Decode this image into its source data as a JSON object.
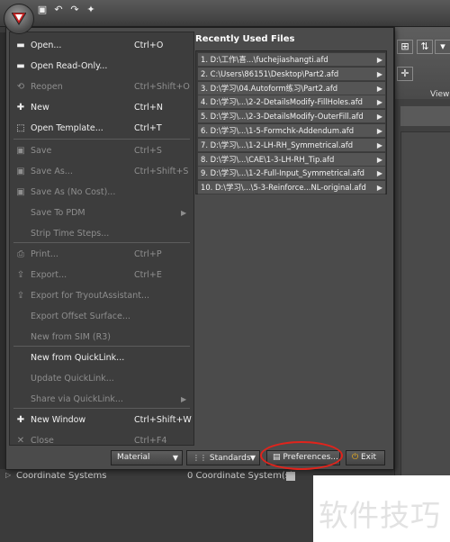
{
  "menu": {
    "items": [
      {
        "icon": "open-folder-icon",
        "label": "Open...",
        "shortcut": "Ctrl+O",
        "enabled": true
      },
      {
        "icon": "open-folder-icon",
        "label": "Open Read-Only...",
        "shortcut": "",
        "enabled": true
      },
      {
        "icon": "reopen-icon",
        "label": "Reopen",
        "shortcut": "Ctrl+Shift+O",
        "enabled": false
      },
      {
        "icon": "new-icon",
        "label": "New",
        "shortcut": "Ctrl+N",
        "enabled": true
      },
      {
        "icon": "template-icon",
        "label": "Open Template...",
        "shortcut": "Ctrl+T",
        "enabled": true
      },
      {
        "icon": "save-icon",
        "label": "Save",
        "shortcut": "Ctrl+S",
        "enabled": false
      },
      {
        "icon": "save-as-icon",
        "label": "Save As...",
        "shortcut": "Ctrl+Shift+S",
        "enabled": false
      },
      {
        "icon": "save-as-icon",
        "label": "Save As (No Cost)...",
        "shortcut": "",
        "enabled": false
      },
      {
        "icon": "",
        "label": "Save To PDM",
        "shortcut": "",
        "enabled": false,
        "submenu": true
      },
      {
        "icon": "",
        "label": "Strip Time Steps...",
        "shortcut": "",
        "enabled": false
      },
      {
        "icon": "print-icon",
        "label": "Print...",
        "shortcut": "Ctrl+P",
        "enabled": false
      },
      {
        "icon": "export-icon",
        "label": "Export...",
        "shortcut": "Ctrl+E",
        "enabled": false
      },
      {
        "icon": "export-icon",
        "label": "Export for TryoutAssistant...",
        "shortcut": "",
        "enabled": false
      },
      {
        "icon": "",
        "label": "Export Offset Surface...",
        "shortcut": "",
        "enabled": false
      },
      {
        "icon": "",
        "label": "New from SIM (R3)",
        "shortcut": "",
        "enabled": false
      },
      {
        "icon": "",
        "label": "New from QuickLink...",
        "shortcut": "",
        "enabled": true
      },
      {
        "icon": "",
        "label": "Update QuickLink...",
        "shortcut": "",
        "enabled": false
      },
      {
        "icon": "",
        "label": "Share via QuickLink...",
        "shortcut": "",
        "enabled": false,
        "submenu": true
      },
      {
        "icon": "new-window-icon",
        "label": "New Window",
        "shortcut": "Ctrl+Shift+W",
        "enabled": true
      },
      {
        "icon": "close-icon",
        "label": "Close",
        "shortcut": "Ctrl+F4",
        "enabled": false
      }
    ],
    "recent_title": "Recently Used Files",
    "recent_files": [
      "1. D:\\工作\\喜...\\fuchejiashangti.afd",
      "2. C:\\Users\\86151\\Desktop\\Part2.afd",
      "3. D:\\学习\\04.Autoform练习\\Part2.afd",
      "4. D:\\学习\\...\\2-2-DetailsModify-FillHoles.afd",
      "5. D:\\学习\\...\\2-3-DetailsModify-OuterFill.afd",
      "6. D:\\学习\\...\\1-5-Formchk-Addendum.afd",
      "7. D:\\学习\\...\\1-2-LH-RH_Symmetrical.afd",
      "8. D:\\学习\\...\\CAE\\1-3-LH-RH_Tip.afd",
      "9. D:\\学习\\...\\1-2-Full-Input_Symmetrical.afd",
      "10. D:\\学习\\...\\5-3-Reinforce...NL-original.afd"
    ],
    "buttons": {
      "material": "Material",
      "standards": "Standards",
      "preferences": "Preferences...",
      "exit": "Exit"
    }
  },
  "background": {
    "view_label": "View",
    "tree_row": {
      "name": "Coordinate Systems",
      "count": "0 Coordinate System(s)"
    },
    "watermark": "软件技巧"
  },
  "colors": {
    "annotation_circle": "#e0241c",
    "menu_bg": "#4b4b4b"
  }
}
